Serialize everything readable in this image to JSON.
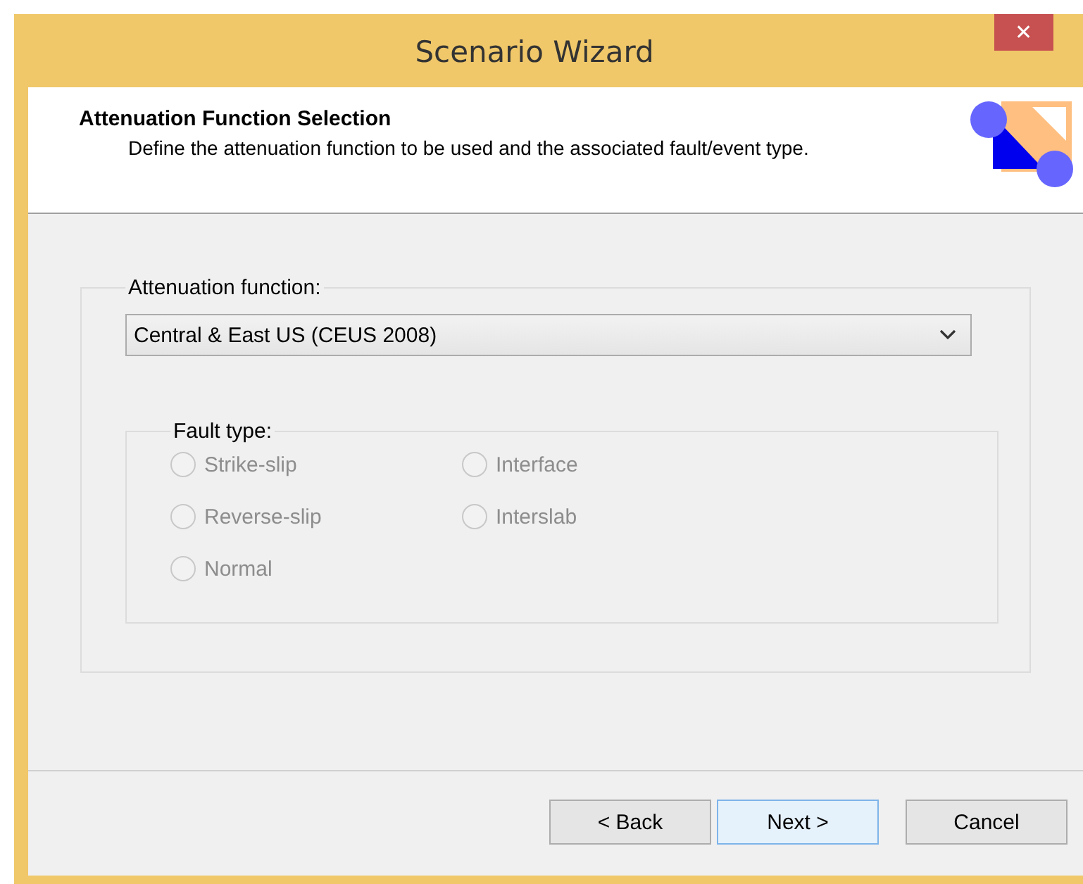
{
  "window": {
    "title": "Scenario Wizard",
    "close_glyph": "✕"
  },
  "header": {
    "title": "Attenuation Function Selection",
    "description": "Define the attenuation function to be used and the associated  fault/event type."
  },
  "attenuation": {
    "label": "Attenuation function:",
    "value": "Central & East US (CEUS 2008)",
    "disabled": false
  },
  "fault_type": {
    "label": "Fault type:",
    "columns": [
      [
        {
          "label": "Strike-slip",
          "selected": false,
          "disabled": true
        },
        {
          "label": "Reverse-slip",
          "selected": false,
          "disabled": true
        },
        {
          "label": "Normal",
          "selected": false,
          "disabled": true
        }
      ],
      [
        {
          "label": "Interface",
          "selected": false,
          "disabled": true
        },
        {
          "label": "Interslab",
          "selected": false,
          "disabled": true
        }
      ]
    ]
  },
  "buttons": [
    {
      "label": "< Back",
      "default": false
    },
    {
      "label": "Next >",
      "default": true
    },
    {
      "label": "Cancel",
      "default": false
    }
  ]
}
